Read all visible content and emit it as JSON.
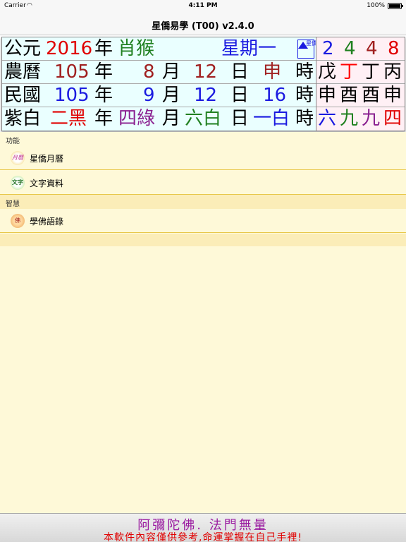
{
  "status_bar": {
    "carrier": "Carrier",
    "wifi_icon": "wifi-icon",
    "time": "4:11 PM",
    "battery": "100%"
  },
  "nav": {
    "title": "星僑易學 (T00) v2.4.0"
  },
  "calendar": {
    "row1": {
      "label": "公元",
      "year": "2016",
      "year_unit": "年",
      "zodiac": "肖猴",
      "weekday": "星期一",
      "logo_text": "星僑",
      "numbers": [
        "2",
        "4",
        "4",
        "8"
      ]
    },
    "row2": {
      "label": "農曆",
      "year": "105",
      "year_unit": "年",
      "month": "8",
      "month_unit": "月",
      "day": "12",
      "day_unit": "日",
      "hour": "申",
      "hour_unit": "時",
      "stems": [
        "戊",
        "丁",
        "丁",
        "丙"
      ]
    },
    "row3": {
      "label": "民國",
      "year": "105",
      "year_unit": "年",
      "month": "9",
      "month_unit": "月",
      "day": "12",
      "day_unit": "日",
      "hour": "16",
      "hour_unit": "時",
      "branches": [
        "申",
        "酉",
        "酉",
        "申"
      ]
    },
    "row4": {
      "label": "紫白",
      "year_star": "二黑",
      "year_unit": "年",
      "month_star": "四綠",
      "month_unit": "月",
      "day_star": "六白",
      "day_unit": "日",
      "hour_star": "一白",
      "hour_unit": "時",
      "stars": [
        "六",
        "九",
        "九",
        "四"
      ]
    }
  },
  "sections": [
    {
      "header": "功能",
      "items": [
        {
          "label": "星僑月曆",
          "icon": "calendar-icon",
          "icon_text": "月曆"
        },
        {
          "label": "文字資料",
          "icon": "text-icon",
          "icon_text": "文字"
        }
      ]
    },
    {
      "header": "智慧",
      "items": [
        {
          "label": "學佛語錄",
          "icon": "buddha-icon",
          "icon_text": "佛"
        }
      ]
    }
  ],
  "footer": {
    "line1": "阿彌陀佛.   法門無量",
    "line2": "本軟件內容僅供參考,命運掌握在自己手裡!"
  }
}
